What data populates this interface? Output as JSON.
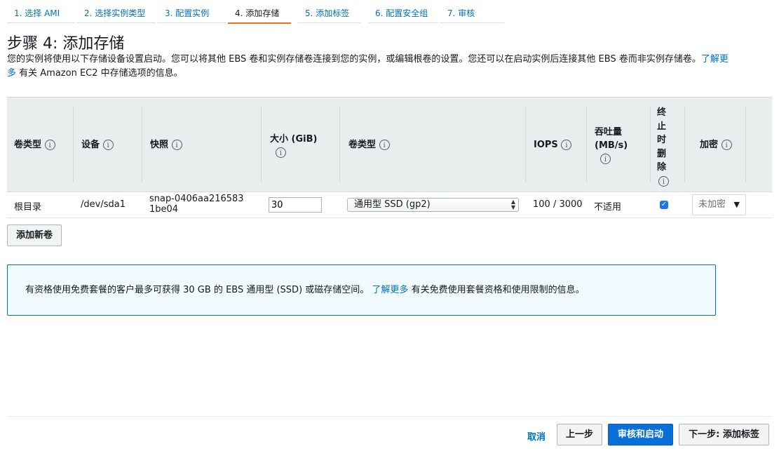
{
  "steps": [
    {
      "label": "1. 选择 AMI"
    },
    {
      "label": "2. 选择实例类型"
    },
    {
      "label": "3. 配置实例"
    },
    {
      "label": "4. 添加存储"
    },
    {
      "label": "5. 添加标签"
    },
    {
      "label": "6. 配置安全组"
    },
    {
      "label": "7. 审核"
    }
  ],
  "page": {
    "title": "步骤 4: 添加存储",
    "desc_part1": "您的实例将使用以下存储设备设置启动。您可以将其他 EBS 卷和实例存储卷连接到您的实例，或编辑根卷的设置。您还可以在启动实例后连接其他 EBS 卷而非实例存储卷。",
    "desc_link": "了解更多",
    "desc_part2": "有关 Amazon EC2 中存储选项的信息。"
  },
  "table": {
    "headers": {
      "volume_type": "卷类型",
      "device": "设备",
      "snapshot": "快照",
      "size": "大小 (GiB)",
      "vol_kind": "卷类型",
      "iops": "IOPS",
      "throughput": "吞吐量 (MB/s)",
      "delete_on_term": "终止时删除",
      "encryption": "加密"
    },
    "info_glyph": "i",
    "row": {
      "volume_type": "根目录",
      "device": "/dev/sda1",
      "snapshot": "snap-0406aa2165831be04",
      "size": "30",
      "vol_kind": "通用型 SSD (gp2)",
      "iops": "100 / 3000",
      "throughput": "不适用",
      "delete_on_term": true,
      "encryption": "未加密"
    }
  },
  "add_volume_label": "添加新卷",
  "notice": {
    "text1": "有资格使用免费套餐的客户最多可获得 30 GB 的 EBS 通用型 (SSD) 或磁存储空间。",
    "link": "了解更多",
    "text2": "有关免费使用套餐资格和使用限制的信息。"
  },
  "footer": {
    "cancel": "取消",
    "previous": "上一步",
    "review_launch": "审核和启动",
    "next": "下一步: 添加标签"
  },
  "colors": {
    "link": "#0073bb",
    "active_step": "#ec7211",
    "primary_button": "#0b6fd8",
    "notice_border": "#0073bb",
    "notice_bg": "#f1faff"
  }
}
